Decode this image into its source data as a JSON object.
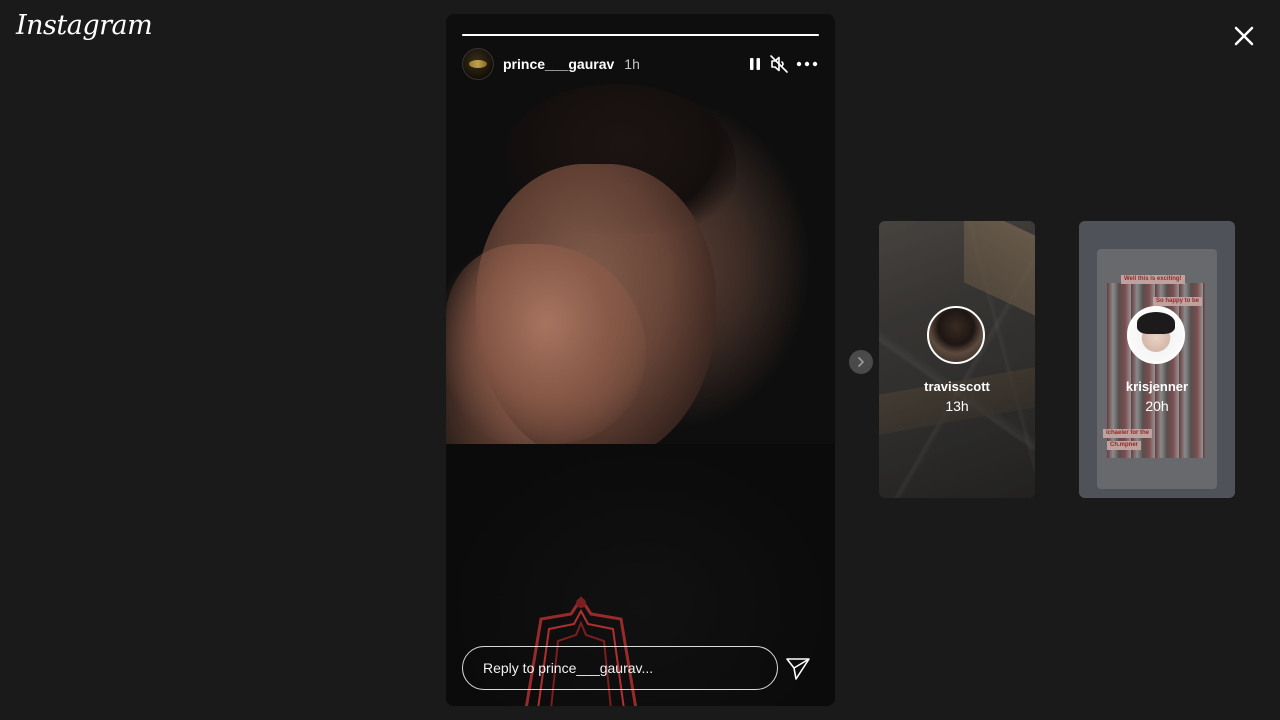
{
  "app": {
    "logo_text": "Instagram"
  },
  "story": {
    "username": "prince___gaurav",
    "time": "1h",
    "progress": 1.0,
    "reply_placeholder": "Reply to prince___gaurav..."
  },
  "icons": {
    "close": "close-icon",
    "pause": "pause-icon",
    "mute": "muted-speaker-icon",
    "more": "more-options-icon",
    "send": "send-icon",
    "next": "chevron-right-icon"
  },
  "previews": [
    {
      "username": "travisscott",
      "time": "13h"
    },
    {
      "username": "krisjenner",
      "time": "20h"
    }
  ],
  "preview_chips": {
    "line1": "Well this is exciting!",
    "line2": "So happy to be",
    "line3": "ichaeler for the",
    "line4": "Ch.mpner"
  },
  "colors": {
    "background": "#1a1a1a",
    "text": "#ffffff"
  }
}
